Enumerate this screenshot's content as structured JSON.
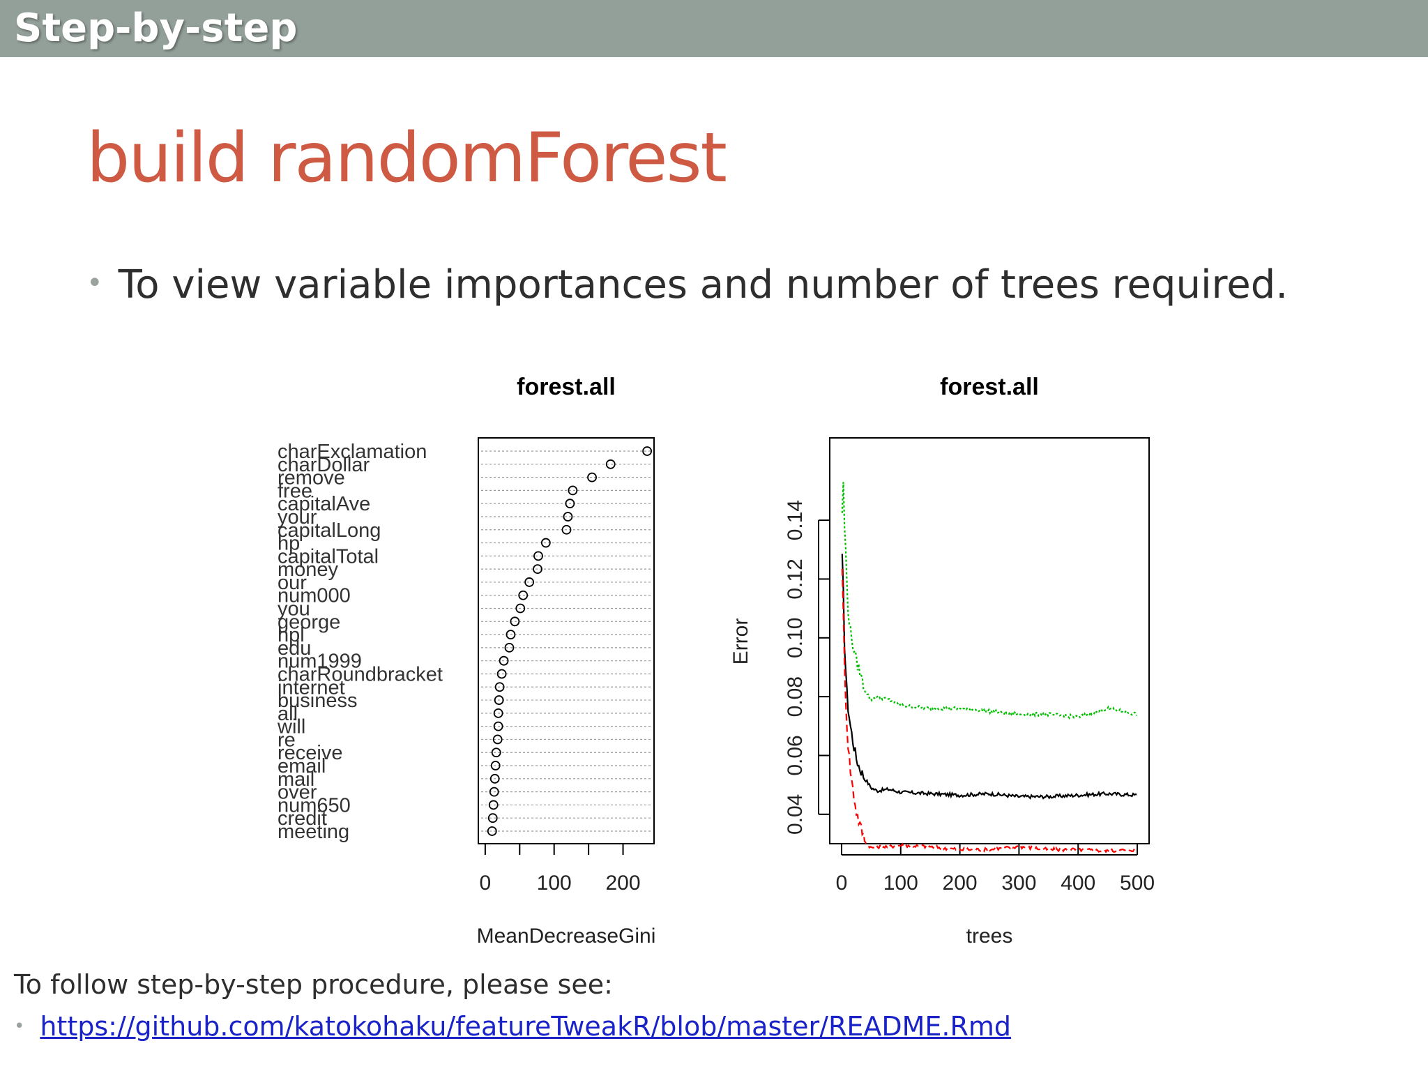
{
  "header": {
    "title": "Step-by-step"
  },
  "slide": {
    "title": "build randomForest",
    "bullet": "To view variable importances and number of trees required."
  },
  "footer": {
    "text": "To follow step-by-step procedure, please see:",
    "link": "https://github.com/katokohaku/featureTweakR/blob/master/README.Rmd"
  },
  "colors": {
    "header_bg": "#939f99",
    "title": "#cf5a43",
    "link": "#1a23c7",
    "series_oob": "#000000",
    "series_class1": "#ff0000",
    "series_class2": "#00c000"
  },
  "chart_data": [
    {
      "type": "scatter",
      "title": "forest.all",
      "xlabel": "MeanDecreaseGini",
      "ylabel": "",
      "xlim": [
        -10,
        245
      ],
      "xticks": [
        0,
        100,
        200
      ],
      "xtick_labels": [
        "0",
        "100",
        "200"
      ],
      "grid": "horizontal-dotted",
      "categories": [
        "charExclamation",
        "charDollar",
        "remove",
        "free",
        "capitalAve",
        "your",
        "capitalLong",
        "hp",
        "capitalTotal",
        "money",
        "our",
        "num000",
        "you",
        "george",
        "hpl",
        "edu",
        "num1999",
        "charRoundbracket",
        "internet",
        "business",
        "all",
        "will",
        "re",
        "receive",
        "email",
        "mail",
        "over",
        "num650",
        "credit",
        "meeting"
      ],
      "values": [
        235,
        182,
        155,
        127,
        123,
        120,
        118,
        88,
        77,
        76,
        64,
        55,
        51,
        43,
        37,
        35,
        27,
        24,
        21,
        20,
        19,
        19,
        18,
        16,
        15,
        14,
        13,
        12,
        11,
        10
      ]
    },
    {
      "type": "line",
      "title": "forest.all",
      "xlabel": "trees",
      "ylabel": "Error",
      "xlim": [
        -20,
        520
      ],
      "ylim": [
        0.03,
        0.168
      ],
      "xticks": [
        0,
        100,
        200,
        300,
        400,
        500
      ],
      "xtick_labels": [
        "0",
        "100",
        "200",
        "300",
        "400",
        "500"
      ],
      "yticks": [
        0.04,
        0.06,
        0.08,
        0.1,
        0.12,
        0.14
      ],
      "ytick_labels": [
        "0.04",
        "0.06",
        "0.08",
        "0.10",
        "0.12",
        "0.14"
      ],
      "grid": false,
      "series": [
        {
          "style": "solid",
          "color": "#000000",
          "x": [
            1,
            3,
            5,
            8,
            10,
            15,
            20,
            25,
            30,
            40,
            50,
            60,
            80,
            100,
            150,
            200,
            250,
            300,
            350,
            400,
            450,
            500
          ],
          "y": [
            0.127,
            0.115,
            0.098,
            0.085,
            0.078,
            0.07,
            0.064,
            0.059,
            0.056,
            0.052,
            0.049,
            0.048,
            0.0485,
            0.0475,
            0.047,
            0.0465,
            0.047,
            0.046,
            0.046,
            0.0465,
            0.047,
            0.0465
          ]
        },
        {
          "style": "dashed",
          "color": "#ff0000",
          "x": [
            1,
            3,
            5,
            8,
            10,
            15,
            20,
            25,
            30,
            40,
            50,
            60,
            80,
            100,
            150,
            200,
            250,
            300,
            350,
            400,
            450,
            500
          ],
          "y": [
            0.125,
            0.108,
            0.09,
            0.075,
            0.066,
            0.055,
            0.047,
            0.041,
            0.037,
            0.031,
            0.0285,
            0.029,
            0.029,
            0.0295,
            0.029,
            0.028,
            0.028,
            0.029,
            0.028,
            0.028,
            0.0275,
            0.028
          ]
        },
        {
          "style": "dotted",
          "color": "#00c000",
          "x": [
            1,
            3,
            5,
            8,
            10,
            15,
            20,
            25,
            30,
            40,
            50,
            60,
            80,
            100,
            150,
            200,
            250,
            300,
            350,
            400,
            450,
            500
          ],
          "y": [
            0.143,
            0.152,
            0.138,
            0.125,
            0.112,
            0.102,
            0.097,
            0.092,
            0.089,
            0.082,
            0.079,
            0.08,
            0.079,
            0.077,
            0.076,
            0.076,
            0.075,
            0.074,
            0.074,
            0.073,
            0.076,
            0.074
          ]
        }
      ]
    }
  ]
}
